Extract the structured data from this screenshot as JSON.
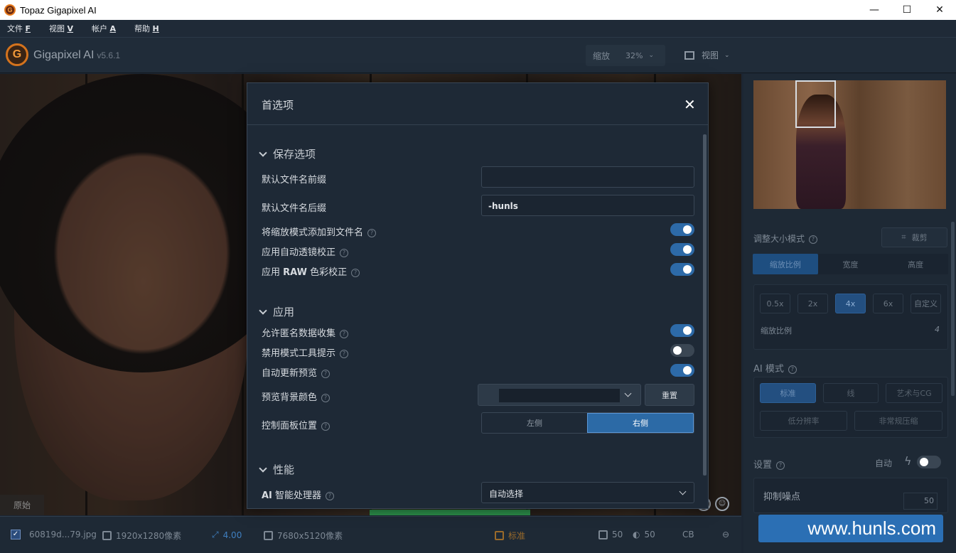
{
  "window": {
    "title": "Topaz Gigapixel AI",
    "logo_letter": "G",
    "minimize": "—",
    "maximize": "☐",
    "close": "✕"
  },
  "menu": [
    {
      "label": "文件",
      "key": "F"
    },
    {
      "label": "视图",
      "key": "V"
    },
    {
      "label": "帐户",
      "key": "A"
    },
    {
      "label": "帮助",
      "key": "H"
    }
  ],
  "toolbar": {
    "app_name": "Gigapixel AI",
    "version": "v5.6.1",
    "zoom_label": "缩放",
    "zoom_value": "32%",
    "view_label": "视图"
  },
  "canvas": {
    "original_tag": "原始"
  },
  "statusbar": {
    "filename": "60819d...79.jpg",
    "input_size": "1920x1280像素",
    "scale": "4.00",
    "output_size": "7680x5120像素",
    "mode": "标准",
    "noise": "50",
    "blur": "50",
    "cb": "CB"
  },
  "dialog": {
    "title": "首选项",
    "close": "✕",
    "sections": {
      "save": {
        "title": "保存选项",
        "prefix_label": "默认文件名前缀",
        "prefix_value": "",
        "suffix_label": "默认文件名后缀",
        "suffix_value": "-hunls",
        "add_scale_label": "将缩放模式添加到文件名",
        "add_scale_on": true,
        "lens_label": "应用自动透镜校正",
        "lens_on": true,
        "raw_label_pre": "应用 ",
        "raw_label_bold": "RAW",
        "raw_label_post": " 色彩校正",
        "raw_on": true
      },
      "app": {
        "title": "应用",
        "anon_label": "允许匿名数据收集",
        "anon_on": true,
        "disable_tips_label": "禁用模式工具提示",
        "disable_tips_on": false,
        "auto_preview_label": "自动更新预览",
        "auto_preview_on": true,
        "bg_color_label": "预览背景颜色",
        "reset_label": "重置",
        "panel_pos_label": "控制面板位置",
        "left_label": "左侧",
        "right_label": "右侧",
        "panel_pos_selected": "右侧"
      },
      "perf": {
        "title": "性能",
        "processor_label_bold": "AI",
        "processor_label_rest": " 智能处理器",
        "processor_value": "自动选择"
      }
    }
  },
  "sidepanel": {
    "resize_mode_label": "调整大小模式",
    "crop_label": "裁剪",
    "resize_tabs": [
      "缩放比例",
      "宽度",
      "高度"
    ],
    "resize_selected": "缩放比例",
    "scale_buttons": [
      "0.5x",
      "2x",
      "4x",
      "6x",
      "自定义"
    ],
    "scale_selected": "4x",
    "scale_ratio_label": "缩放比例",
    "scale_ratio_value": "4",
    "ai_mode_label": "AI 模式",
    "ai_modes_row1": [
      "标准",
      "线",
      "艺术与CG"
    ],
    "ai_modes_row2": [
      "低分辨率",
      "非常规压缩"
    ],
    "ai_selected": "标准",
    "settings_label": "设置",
    "auto_label": "自动",
    "auto_on": false,
    "noise_label": "抑制噪点",
    "noise_value": "50",
    "watermark": "www.hunls.com"
  },
  "colors": {
    "accent": "#2c6aa6",
    "toggle_on": "#2d6aa8",
    "panel_bg": "#1e2936"
  }
}
